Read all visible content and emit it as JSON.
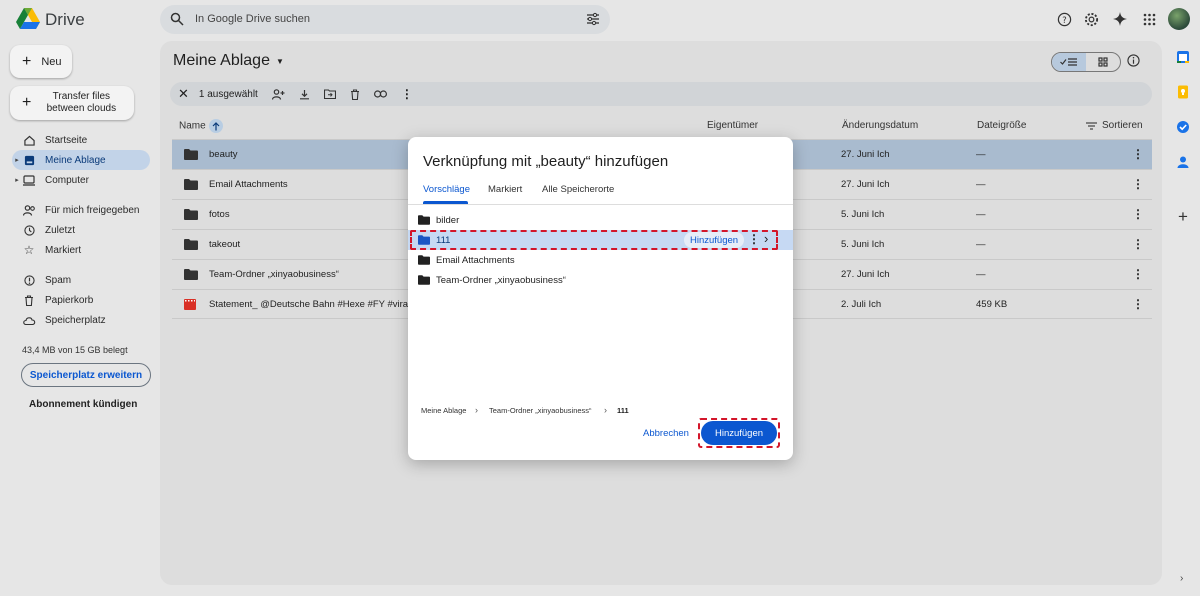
{
  "app": {
    "name": "Drive"
  },
  "search": {
    "placeholder": "In Google Drive suchen"
  },
  "sidebar": {
    "new_label": "Neu",
    "transfer_label": "Transfer files between clouds",
    "items": [
      {
        "label": "Startseite",
        "icon": "home-icon"
      },
      {
        "label": "Meine Ablage",
        "icon": "drive-icon",
        "active": true
      },
      {
        "label": "Computer",
        "icon": "computer-icon"
      },
      {
        "label": "Für mich freigegeben",
        "icon": "shared-icon"
      },
      {
        "label": "Zuletzt",
        "icon": "clock-icon"
      },
      {
        "label": "Markiert",
        "icon": "star-icon"
      },
      {
        "label": "Spam",
        "icon": "spam-icon"
      },
      {
        "label": "Papierkorb",
        "icon": "trash-icon"
      },
      {
        "label": "Speicherplatz",
        "icon": "cloud-icon"
      }
    ],
    "storage_text": "43,4 MB von 15 GB belegt",
    "storage_button": "Speicherplatz erweitern",
    "cancel_subscription": "Abonnement kündigen"
  },
  "main": {
    "title": "Meine Ablage",
    "selection_text": "1 ausgewählt",
    "columns": {
      "name": "Name",
      "owner": "Eigentümer",
      "date": "Änderungsdatum",
      "size": "Dateigröße",
      "sort": "Sortieren"
    },
    "rows": [
      {
        "name": "beauty",
        "date": "27. Juni Ich",
        "size": "—",
        "selected": true,
        "type": "folder"
      },
      {
        "name": "Email Attachments",
        "date": "27. Juni Ich",
        "size": "—",
        "type": "folder"
      },
      {
        "name": "fotos",
        "date": "5. Juni Ich",
        "size": "—",
        "type": "folder"
      },
      {
        "name": "takeout",
        "date": "5. Juni Ich",
        "size": "—",
        "type": "folder"
      },
      {
        "name": "Team-Ordner „xinyaobusiness“",
        "date": "27. Juni Ich",
        "size": "—",
        "type": "folder"
      },
      {
        "name": "Statement_ @Deutsche Bahn #Hexe #FY #viral #",
        "date": "2. Juli Ich",
        "size": "459 KB",
        "type": "video"
      }
    ]
  },
  "dialog": {
    "title": "Verknüpfung mit „beauty“ hinzufügen",
    "tabs": [
      "Vorschläge",
      "Markiert",
      "Alle Speicherorte"
    ],
    "items": [
      "bilder",
      "111",
      "Email Attachments",
      "Team-Ordner „xinyaobusiness“"
    ],
    "inline_add": "Hinzufügen",
    "breadcrumb": [
      "Meine Ablage",
      "Team-Ordner „xinyaobusiness“",
      "111"
    ],
    "cancel": "Abbrechen",
    "confirm": "Hinzufügen"
  },
  "colors": {
    "accent": "#0b57d0",
    "highlight": "#d3162a",
    "selected_row": "#a9bbcf"
  }
}
